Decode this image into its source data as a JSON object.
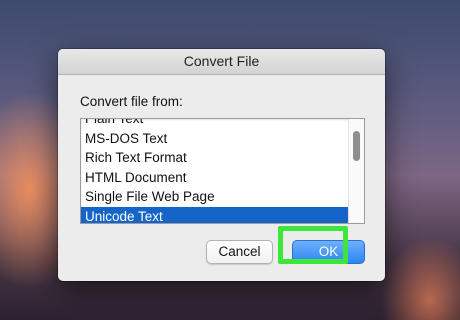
{
  "dialog": {
    "title": "Convert File",
    "from_label": "Convert file from:",
    "options": [
      "Plain Text",
      "MS-DOS Text",
      "Rich Text Format",
      "HTML Document",
      "Single File Web Page",
      "Unicode Text"
    ],
    "selected_option": "Unicode Text",
    "buttons": {
      "cancel_label": "Cancel",
      "ok_label": "OK"
    }
  },
  "colors": {
    "selection": "#1565c8",
    "ok_button": "#2b86f0",
    "highlight": "#3ee63c"
  }
}
